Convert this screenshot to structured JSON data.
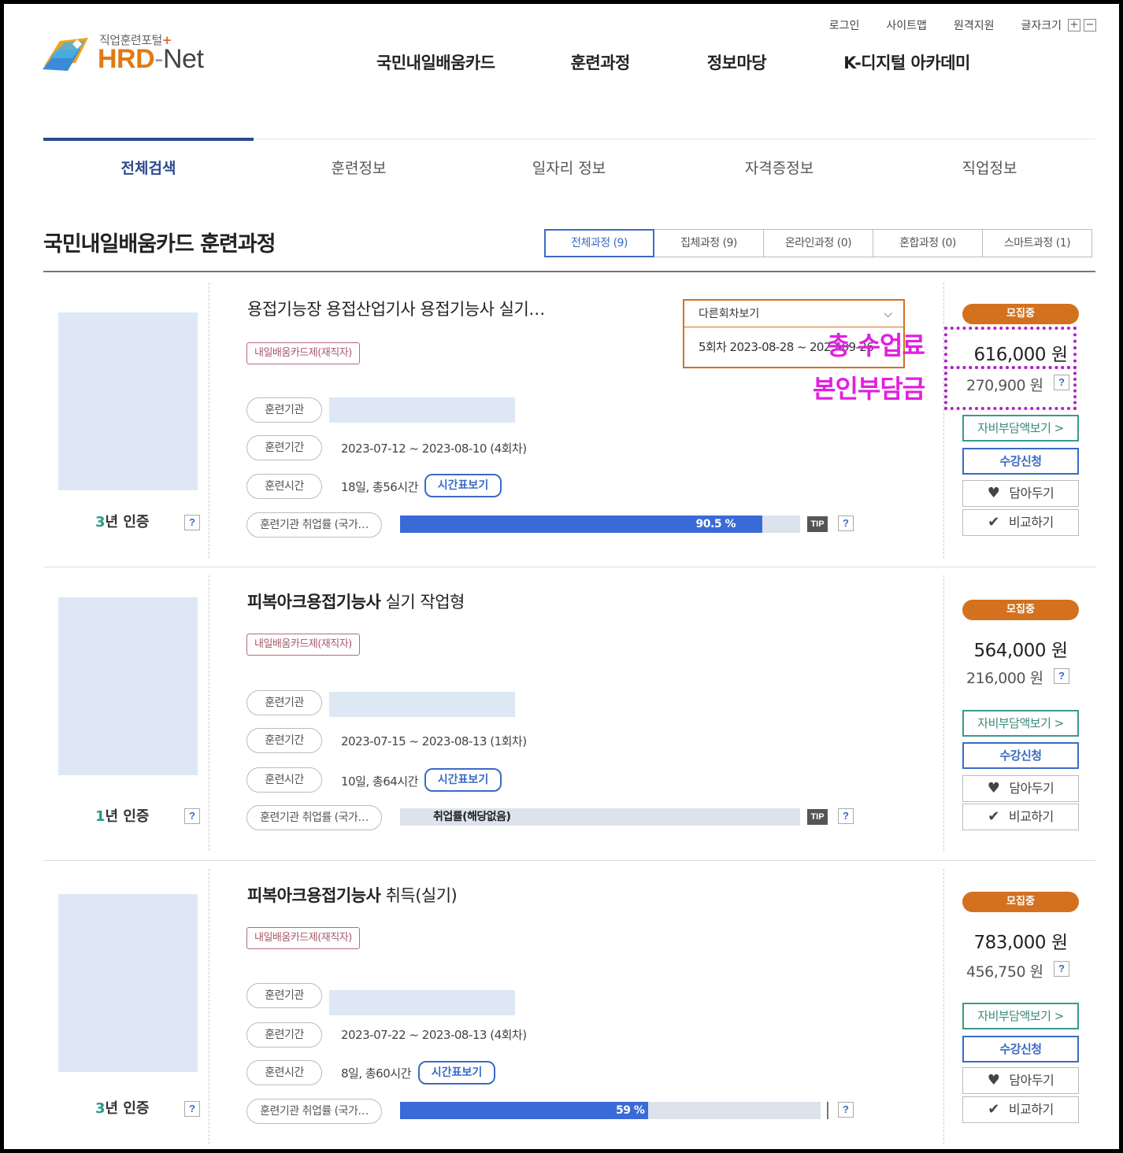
{
  "header": {
    "logo_sub": "직업훈련포털",
    "logo_plus": "+",
    "logo_hrd": "HRD",
    "logo_dash": "-",
    "logo_net": "Net",
    "util": [
      "로그인",
      "사이트맵",
      "원격지원",
      "글자크기"
    ],
    "font_plus": "+",
    "font_minus": "−",
    "gnb": [
      "국민내일배움카드",
      "훈련과정",
      "정보마당",
      "K-디지털 아카데미"
    ]
  },
  "snb": {
    "tabs": [
      "전체검색",
      "훈련정보",
      "일자리 정보",
      "자격증정보",
      "직업정보"
    ],
    "active": 0
  },
  "section": {
    "title": "국민내일배움카드 훈련과정",
    "filters": [
      "전체과정 (9)",
      "집체과정 (9)",
      "온라인과정 (0)",
      "혼합과정 (0)",
      "스마트과정 (1)"
    ]
  },
  "labels": {
    "institution": "훈련기관",
    "period": "훈련기간",
    "time": "훈련시간",
    "employment": "훈련기관 취업률 (국가…",
    "timetable": "시간표보기",
    "tip": "TIP",
    "q": "?",
    "status": "모집중",
    "self_pay_view": "자비부담액보기 >",
    "apply": "수강신청",
    "save": "담아두기",
    "compare": "비교하기",
    "cert_suffix": "년 인증"
  },
  "courses": [
    {
      "title_bold": "",
      "title_rest": "용접기능장 용접산업기사 용접기능사 실기…",
      "card_type": "내일배움카드제(재직자)",
      "period": "2023-07-12 ~ 2023-08-10 (4회차)",
      "hours": "18일, 총56시간",
      "employment_rate": 90.5,
      "employment_text": "90.5 %",
      "cert_years": "3",
      "total_fee": "616,000 원",
      "self_pay": "270,900 원"
    },
    {
      "title_bold": "피복아크용접기능사",
      "title_rest": " 실기 작업형",
      "card_type": "내일배움카드제(재직자)",
      "period": "2023-07-15 ~ 2023-08-13 (1회차)",
      "hours": "10일, 총64시간",
      "employment_rate": 0,
      "employment_text": "취업률(해당없음)",
      "cert_years": "1",
      "total_fee": "564,000 원",
      "self_pay": "216,000 원"
    },
    {
      "title_bold": "피복아크용접기능사",
      "title_rest": " 취득(실기)",
      "card_type": "내일배움카드제(재직자)",
      "period": "2023-07-22 ~ 2023-08-13 (4회차)",
      "hours": "8일, 총60시간",
      "employment_rate": 59,
      "employment_text": "59 %",
      "cert_years": "3",
      "total_fee": "783,000 원",
      "self_pay": "456,750 원"
    }
  ],
  "dropdown": {
    "head": "다른회차보기",
    "option": "5회차 2023-08-28 ~ 2023-09-26"
  },
  "annotations": {
    "total_fee": "총 수업료",
    "self_pay": "본인부담금"
  },
  "colors": {
    "accent_blue": "#3a6bc4",
    "status_orange": "#d3711f",
    "annotation_magenta": "#e020e0"
  }
}
